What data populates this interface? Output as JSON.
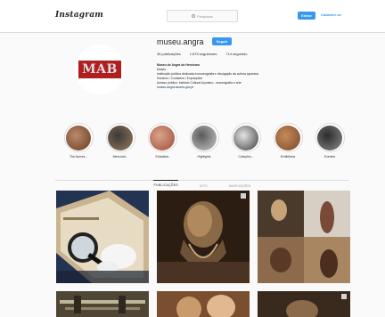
{
  "topbar": {
    "logo_text": "Instagram",
    "search_placeholder": "Pesquisar",
    "login_label": "Entrar",
    "signup_label": "Cadastre-se"
  },
  "profile": {
    "logo_text": "MAB",
    "username": "museu.angra",
    "follow_label": "Seguir",
    "stats": [
      "35 publicações",
      "1.875 seguidores",
      "714 seguindo"
    ],
    "bio": {
      "name": "Museu de Angra do Heroísmo",
      "category": "Museu",
      "line1": "Instituição pública dedicada à museografia e divulgação da cultura açoriana",
      "line2": "Horários / Contactos / Exposições",
      "line3": "Acesso público: Instituto Cultural Açoriano - museografia e arte",
      "link": "museu-angra.azores.gov.pt"
    }
  },
  "highlights": [
    {
      "label": "The Azores...",
      "color": "#b9896a",
      "color2": "#6b3b22"
    },
    {
      "label": "Memorial...",
      "color": "#3a3a3a",
      "color2": "#9b7a5c"
    },
    {
      "label": "Educativo",
      "color": "#d9a58a",
      "color2": "#a04a3a"
    },
    {
      "label": "Highlights",
      "color": "#5a5a5a",
      "color2": "#c8c8c8"
    },
    {
      "label": "Coleções...",
      "color": "#e4e4e4",
      "color2": "#3b3b3b"
    },
    {
      "label": "Exhibitions",
      "color": "#c48a5a",
      "color2": "#7a4a2a"
    },
    {
      "label": "Eventos",
      "color": "#2c2c2c",
      "color2": "#8a8a8a"
    }
  ],
  "tabs": [
    "PUBLICAÇÕES",
    "IGTV",
    "MARCAÇÕES"
  ],
  "posts": [
    {
      "subject": "magnifying-glass",
      "bg": "#2d3b59"
    },
    {
      "subject": "bearded-sculpture",
      "bg": "#3b2a1c"
    },
    {
      "subject": "collage",
      "bg": "#6d5a48"
    },
    {
      "subject": "swords",
      "bg": "#5a5040"
    },
    {
      "subject": "figure",
      "bg": "#8a5a3a"
    },
    {
      "subject": "figure-dark",
      "bg": "#3a2a20"
    }
  ]
}
